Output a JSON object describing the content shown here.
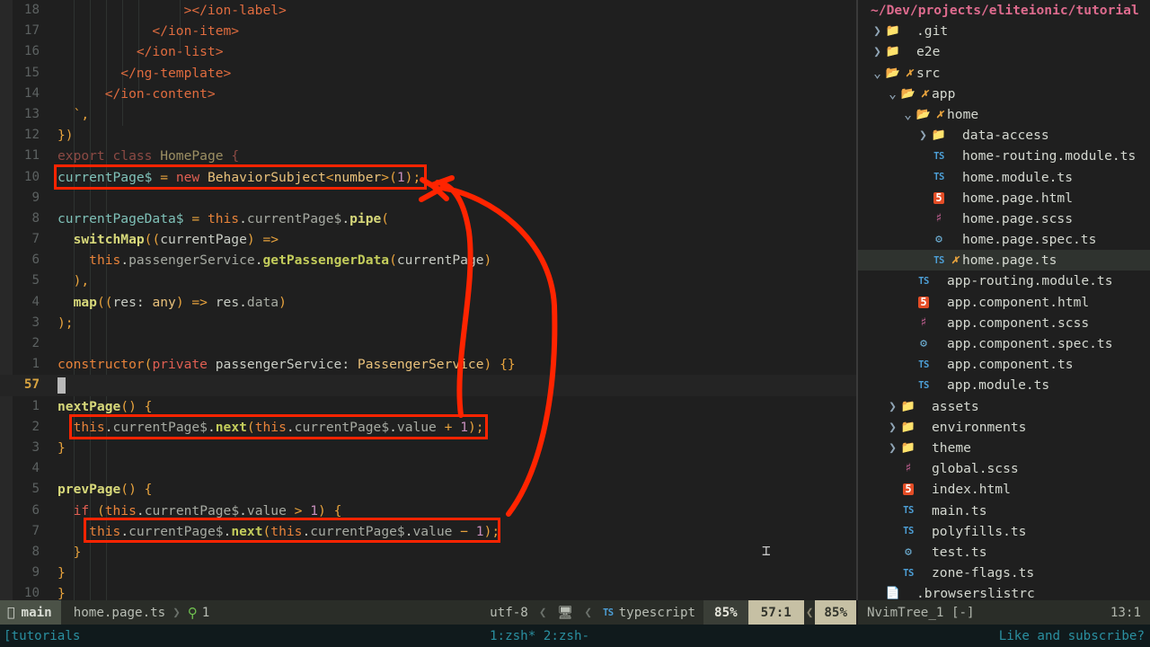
{
  "editor": {
    "lines": [
      {
        "num": "18",
        "indent": 0,
        "segs": [
          {
            "t": "                ></ion-label>",
            "c": "tag"
          }
        ]
      },
      {
        "num": "17",
        "indent": 0,
        "segs": [
          {
            "t": "            </ion-item>",
            "c": "tag"
          }
        ]
      },
      {
        "num": "16",
        "indent": 0,
        "segs": [
          {
            "t": "          </ion-list>",
            "c": "tag"
          }
        ]
      },
      {
        "num": "15",
        "indent": 0,
        "segs": [
          {
            "t": "        </ng-template>",
            "c": "tag"
          }
        ]
      },
      {
        "num": "14",
        "indent": 0,
        "segs": [
          {
            "t": "      </ion-content>",
            "c": "tag"
          }
        ]
      },
      {
        "num": "13",
        "indent": 0,
        "segs": [
          {
            "t": "  `,",
            "c": "punc"
          }
        ]
      },
      {
        "num": "12",
        "indent": 0,
        "segs": [
          {
            "t": "})",
            "c": "punc"
          }
        ]
      },
      {
        "num": "11",
        "indent": 0,
        "segs": [
          {
            "t": "export class ",
            "c": "faded"
          },
          {
            "t": "HomePage ",
            "c": "faded2"
          },
          {
            "t": "{",
            "c": "faded"
          }
        ]
      },
      {
        "num": "10",
        "indent": 0,
        "segs": [
          {
            "t": "currentPage$ ",
            "c": "var"
          },
          {
            "t": "= ",
            "c": "op"
          },
          {
            "t": "new ",
            "c": "kw"
          },
          {
            "t": "BehaviorSubject",
            "c": "type"
          },
          {
            "t": "<",
            "c": "op"
          },
          {
            "t": "number",
            "c": "type"
          },
          {
            "t": ">",
            "c": "op"
          },
          {
            "t": "(",
            "c": "punc"
          },
          {
            "t": "1",
            "c": "num"
          },
          {
            "t": ");",
            "c": "punc"
          }
        ]
      },
      {
        "num": "9",
        "indent": 0,
        "segs": []
      },
      {
        "num": "8",
        "indent": 0,
        "segs": [
          {
            "t": "currentPageData$ ",
            "c": "var"
          },
          {
            "t": "= ",
            "c": "op"
          },
          {
            "t": "this",
            "c": "kw2"
          },
          {
            "t": ".",
            "c": "plain"
          },
          {
            "t": "currentPage$",
            "c": "prop"
          },
          {
            "t": ".",
            "c": "plain"
          },
          {
            "t": "pipe",
            "c": "fn"
          },
          {
            "t": "(",
            "c": "punc"
          }
        ]
      },
      {
        "num": "7",
        "indent": 0,
        "segs": [
          {
            "t": "  ",
            "c": "plain"
          },
          {
            "t": "switchMap",
            "c": "fn"
          },
          {
            "t": "((",
            "c": "punc"
          },
          {
            "t": "currentPage",
            "c": "plain"
          },
          {
            "t": ") ",
            "c": "punc"
          },
          {
            "t": "=>",
            "c": "op"
          }
        ]
      },
      {
        "num": "6",
        "indent": 0,
        "segs": [
          {
            "t": "    ",
            "c": "plain"
          },
          {
            "t": "this",
            "c": "kw2"
          },
          {
            "t": ".",
            "c": "plain"
          },
          {
            "t": "passengerService",
            "c": "prop"
          },
          {
            "t": ".",
            "c": "plain"
          },
          {
            "t": "getPassengerData",
            "c": "fn2"
          },
          {
            "t": "(",
            "c": "punc"
          },
          {
            "t": "currentPage",
            "c": "plain"
          },
          {
            "t": ")",
            "c": "punc"
          }
        ]
      },
      {
        "num": "5",
        "indent": 0,
        "segs": [
          {
            "t": "  ),",
            "c": "punc"
          }
        ]
      },
      {
        "num": "4",
        "indent": 0,
        "segs": [
          {
            "t": "  ",
            "c": "plain"
          },
          {
            "t": "map",
            "c": "fn"
          },
          {
            "t": "((",
            "c": "punc"
          },
          {
            "t": "res",
            "c": "plain"
          },
          {
            "t": ": ",
            "c": "plain"
          },
          {
            "t": "any",
            "c": "type"
          },
          {
            "t": ") ",
            "c": "punc"
          },
          {
            "t": "=> ",
            "c": "op"
          },
          {
            "t": "res",
            "c": "plain"
          },
          {
            "t": ".",
            "c": "plain"
          },
          {
            "t": "data",
            "c": "prop"
          },
          {
            "t": ")",
            "c": "punc"
          }
        ]
      },
      {
        "num": "3",
        "indent": 0,
        "segs": [
          {
            "t": ");",
            "c": "punc"
          }
        ]
      },
      {
        "num": "2",
        "indent": 0,
        "segs": []
      },
      {
        "num": "1",
        "indent": 0,
        "segs": [
          {
            "t": "constructor",
            "c": "kw2"
          },
          {
            "t": "(",
            "c": "punc"
          },
          {
            "t": "private ",
            "c": "kw"
          },
          {
            "t": "passengerService",
            "c": "plain"
          },
          {
            "t": ": ",
            "c": "plain"
          },
          {
            "t": "PassengerService",
            "c": "type"
          },
          {
            "t": ") ",
            "c": "punc"
          },
          {
            "t": "{}",
            "c": "punc"
          }
        ]
      },
      {
        "num": "57",
        "current": true,
        "indent": 0,
        "segs": []
      },
      {
        "num": "1",
        "indent": 0,
        "segs": [
          {
            "t": "nextPage",
            "c": "fn"
          },
          {
            "t": "() {",
            "c": "punc"
          }
        ]
      },
      {
        "num": "2",
        "indent": 0,
        "segs": [
          {
            "t": "  ",
            "c": "plain"
          },
          {
            "t": "this",
            "c": "kw2"
          },
          {
            "t": ".",
            "c": "plain"
          },
          {
            "t": "currentPage$",
            "c": "prop"
          },
          {
            "t": ".",
            "c": "plain"
          },
          {
            "t": "next",
            "c": "fn2"
          },
          {
            "t": "(",
            "c": "punc"
          },
          {
            "t": "this",
            "c": "kw2"
          },
          {
            "t": ".",
            "c": "plain"
          },
          {
            "t": "currentPage$",
            "c": "prop"
          },
          {
            "t": ".",
            "c": "plain"
          },
          {
            "t": "value ",
            "c": "prop"
          },
          {
            "t": "+ ",
            "c": "op"
          },
          {
            "t": "1",
            "c": "num"
          },
          {
            "t": ");",
            "c": "punc"
          }
        ]
      },
      {
        "num": "3",
        "indent": 0,
        "segs": [
          {
            "t": "}",
            "c": "punc"
          }
        ]
      },
      {
        "num": "4",
        "indent": 0,
        "segs": []
      },
      {
        "num": "5",
        "indent": 0,
        "segs": [
          {
            "t": "prevPage",
            "c": "fn"
          },
          {
            "t": "() {",
            "c": "punc"
          }
        ]
      },
      {
        "num": "6",
        "indent": 0,
        "segs": [
          {
            "t": "  ",
            "c": "plain"
          },
          {
            "t": "if ",
            "c": "kw"
          },
          {
            "t": "(",
            "c": "punc"
          },
          {
            "t": "this",
            "c": "kw2"
          },
          {
            "t": ".",
            "c": "plain"
          },
          {
            "t": "currentPage$",
            "c": "prop"
          },
          {
            "t": ".",
            "c": "plain"
          },
          {
            "t": "value ",
            "c": "prop"
          },
          {
            "t": "> ",
            "c": "op"
          },
          {
            "t": "1",
            "c": "num"
          },
          {
            "t": ") {",
            "c": "punc"
          }
        ]
      },
      {
        "num": "7",
        "indent": 0,
        "segs": [
          {
            "t": "    ",
            "c": "plain"
          },
          {
            "t": "this",
            "c": "kw2"
          },
          {
            "t": ".",
            "c": "plain"
          },
          {
            "t": "currentPage$",
            "c": "prop"
          },
          {
            "t": ".",
            "c": "plain"
          },
          {
            "t": "next",
            "c": "fn2"
          },
          {
            "t": "(",
            "c": "punc"
          },
          {
            "t": "this",
            "c": "kw2"
          },
          {
            "t": ".",
            "c": "plain"
          },
          {
            "t": "currentPage$",
            "c": "prop"
          },
          {
            "t": ".",
            "c": "plain"
          },
          {
            "t": "value ",
            "c": "prop"
          },
          {
            "t": "− ",
            "c": "op"
          },
          {
            "t": "1",
            "c": "num"
          },
          {
            "t": ");",
            "c": "punc"
          }
        ]
      },
      {
        "num": "8",
        "indent": 0,
        "segs": [
          {
            "t": "  }",
            "c": "punc"
          }
        ]
      },
      {
        "num": "9",
        "indent": 0,
        "segs": [
          {
            "t": "}",
            "c": "punc"
          }
        ]
      },
      {
        "num": "10",
        "indent": 0,
        "segs": [
          {
            "t": "}",
            "c": "punc"
          }
        ]
      }
    ],
    "annotation_color": "#ff2400"
  },
  "tree": {
    "title": "~/Dev/projects/eliteionic/tutorial",
    "nodes": [
      {
        "depth": 0,
        "arrow": "closed",
        "icon": "folder",
        "git": "",
        "label": ".git"
      },
      {
        "depth": 0,
        "arrow": "closed",
        "icon": "folder",
        "git": "",
        "label": "e2e"
      },
      {
        "depth": 0,
        "arrow": "open",
        "icon": "folder-open",
        "git": "✗",
        "label": "src"
      },
      {
        "depth": 1,
        "arrow": "open",
        "icon": "folder-open",
        "git": "✗",
        "label": "app"
      },
      {
        "depth": 2,
        "arrow": "open",
        "icon": "folder-open",
        "git": "✗",
        "label": "home"
      },
      {
        "depth": 3,
        "arrow": "closed",
        "icon": "folder",
        "git": "",
        "label": "data-access"
      },
      {
        "depth": 3,
        "arrow": "none",
        "icon": "ts",
        "git": "",
        "label": "home-routing.module.ts"
      },
      {
        "depth": 3,
        "arrow": "none",
        "icon": "ts",
        "git": "",
        "label": "home.module.ts"
      },
      {
        "depth": 3,
        "arrow": "none",
        "icon": "html",
        "git": "",
        "label": "home.page.html"
      },
      {
        "depth": 3,
        "arrow": "none",
        "icon": "scss",
        "git": "",
        "label": "home.page.scss"
      },
      {
        "depth": 3,
        "arrow": "none",
        "icon": "test",
        "git": "",
        "label": "home.page.spec.ts"
      },
      {
        "depth": 3,
        "arrow": "none",
        "icon": "ts",
        "git": "✗",
        "label": "home.page.ts",
        "selected": true
      },
      {
        "depth": 2,
        "arrow": "none",
        "icon": "ts",
        "git": "",
        "label": "app-routing.module.ts"
      },
      {
        "depth": 2,
        "arrow": "none",
        "icon": "html",
        "git": "",
        "label": "app.component.html"
      },
      {
        "depth": 2,
        "arrow": "none",
        "icon": "scss",
        "git": "",
        "label": "app.component.scss"
      },
      {
        "depth": 2,
        "arrow": "none",
        "icon": "test",
        "git": "",
        "label": "app.component.spec.ts"
      },
      {
        "depth": 2,
        "arrow": "none",
        "icon": "ts",
        "git": "",
        "label": "app.component.ts"
      },
      {
        "depth": 2,
        "arrow": "none",
        "icon": "ts",
        "git": "",
        "label": "app.module.ts"
      },
      {
        "depth": 1,
        "arrow": "closed",
        "icon": "folder",
        "git": "",
        "label": "assets"
      },
      {
        "depth": 1,
        "arrow": "closed",
        "icon": "folder",
        "git": "",
        "label": "environments"
      },
      {
        "depth": 1,
        "arrow": "closed",
        "icon": "folder",
        "git": "",
        "label": "theme"
      },
      {
        "depth": 1,
        "arrow": "none",
        "icon": "scss",
        "git": "",
        "label": "global.scss"
      },
      {
        "depth": 1,
        "arrow": "none",
        "icon": "html",
        "git": "",
        "label": "index.html"
      },
      {
        "depth": 1,
        "arrow": "none",
        "icon": "ts",
        "git": "",
        "label": "main.ts"
      },
      {
        "depth": 1,
        "arrow": "none",
        "icon": "ts",
        "git": "",
        "label": "polyfills.ts"
      },
      {
        "depth": 1,
        "arrow": "none",
        "icon": "test",
        "git": "",
        "label": "test.ts"
      },
      {
        "depth": 1,
        "arrow": "none",
        "icon": "ts",
        "git": "",
        "label": "zone-flags.ts"
      },
      {
        "depth": 0,
        "arrow": "none",
        "icon": "doc",
        "git": "",
        "label": ".browserslistrc"
      }
    ]
  },
  "statusline": {
    "branch": "main",
    "branch_icon": "git-branch-icon",
    "filename": "home.page.ts",
    "separator": "❯",
    "diagnostic_icon": "lightbulb-icon",
    "diagnostic_count": "1",
    "encoding": "utf-8",
    "format_icon": "unix-icon",
    "lang_icon": "ts-icon",
    "language": "typescript",
    "percent_left": "85%",
    "position": "57:1",
    "percent_right": "85%"
  },
  "treestatus": {
    "name": "NvimTree_1 [-]",
    "position": "13:1"
  },
  "tmux": {
    "session": "[tutorials",
    "windows": "1:zsh* 2:zsh-",
    "right": "Like and subscribe?"
  }
}
